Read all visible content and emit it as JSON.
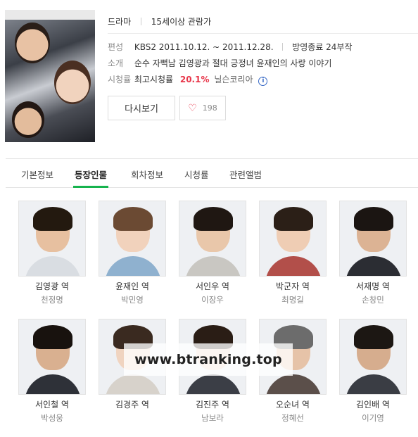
{
  "drama": {
    "genre": "드라마",
    "age_rating": "15세이상 관람가",
    "broadcast_label": "편성",
    "broadcast_value": "KBS2 2011.10.12. ~ 2011.12.28.",
    "status": "방영종료 24부작",
    "intro_label": "소개",
    "intro_value": "순수 자뻑남 김영광과 절대 긍정녀 윤재인의 사랑 이야기",
    "ratings_label": "시청률",
    "ratings_prefix": "최고시청률",
    "ratings_value": "20.1%",
    "ratings_source": "닐슨코리아",
    "info_icon": "i"
  },
  "buttons": {
    "rewatch_label": "다시보기",
    "like_count": "198"
  },
  "tabs": [
    "기본정보",
    "등장인물",
    "회차정보",
    "시청률",
    "관련앨범"
  ],
  "active_tab": "등장인물",
  "cast": [
    {
      "role": "김영광 역",
      "actor": "천정명",
      "skin": "#e7c0a0",
      "hair": "#23190f",
      "body": "#d9dde2"
    },
    {
      "role": "윤재인 역",
      "actor": "박민영",
      "skin": "#f1d2bc",
      "hair": "#6b4a33",
      "body": "#8fb1cf"
    },
    {
      "role": "서인우 역",
      "actor": "이장우",
      "skin": "#e9c7aa",
      "hair": "#1f1712",
      "body": "#c9c7c2"
    },
    {
      "role": "박군자 역",
      "actor": "최명길",
      "skin": "#efcdb4",
      "hair": "#2b1f17",
      "body": "#b24f4a"
    },
    {
      "role": "서재명 역",
      "actor": "손창민",
      "skin": "#dcb394",
      "hair": "#1b1512",
      "body": "#2b2d33"
    },
    {
      "role": "서인철 역",
      "actor": "박성웅",
      "skin": "#d9b090",
      "hair": "#18120e",
      "body": "#2e3138"
    },
    {
      "role": "김경주 역",
      "actor": "",
      "skin": "#f0d4c0",
      "hair": "#3a2a20",
      "body": "#d7d2cb"
    },
    {
      "role": "김진주 역",
      "actor": "남보라",
      "skin": "#f2d3bd",
      "hair": "#2a1d15",
      "body": "#3b3e46"
    },
    {
      "role": "오순녀 역",
      "actor": "정혜선",
      "skin": "#e6c3a8",
      "hair": "#6c6c6c",
      "body": "#5b4f4a"
    },
    {
      "role": "김인배 역",
      "actor": "이기영",
      "skin": "#d6ad8e",
      "hair": "#1c1713",
      "body": "#3a3d44"
    }
  ],
  "watermark": "www.btranking.top",
  "colors": {
    "accent_green": "#16b34e",
    "rating_red": "#e8364a",
    "info_blue": "#3a6bc6"
  }
}
